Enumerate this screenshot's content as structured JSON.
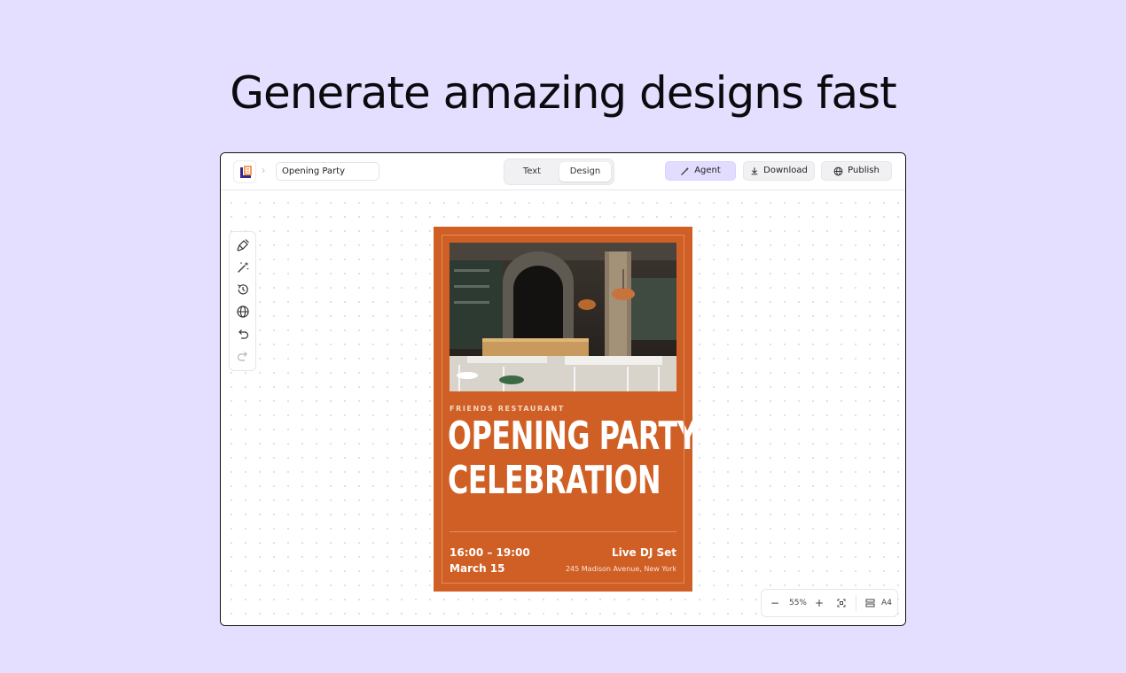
{
  "headline": "Generate amazing designs fast",
  "topbar": {
    "document_name": "Opening Party",
    "modes": {
      "text": "Text",
      "design": "Design",
      "active": "Design"
    },
    "agent_label": "Agent",
    "download_label": "Download",
    "publish_label": "Publish"
  },
  "tools": [
    {
      "icon": "paintbrush-icon"
    },
    {
      "icon": "magic-wand-icon"
    },
    {
      "icon": "history-icon"
    },
    {
      "icon": "globe-icon"
    },
    {
      "icon": "undo-icon"
    },
    {
      "icon": "redo-icon"
    }
  ],
  "poster": {
    "background": "#d05f25",
    "kicker": "FRIENDS RESTAURANT",
    "headline_line1": "OPENING PARTY",
    "headline_line2": "CELEBRATION",
    "time": "16:00 – 19:00",
    "date": "March 15",
    "event": "Live DJ Set",
    "address": "245 Madison Avenue, New York"
  },
  "zoom": {
    "minus": "−",
    "level": "55%",
    "plus": "+",
    "page_size": "A4"
  },
  "colors": {
    "page_background": "#e4dfff",
    "agent_button": "#e2dcff"
  }
}
